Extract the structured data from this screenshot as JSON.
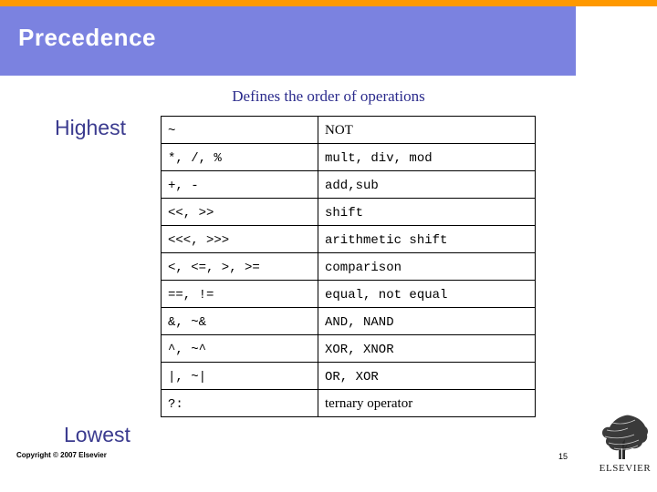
{
  "slide": {
    "title": "Precedence",
    "subtitle": "Defines the order of operations",
    "label_highest": "Highest",
    "label_lowest": "Lowest",
    "copyright": "Copyright © 2007 Elsevier",
    "page_number": "15",
    "logo_text": "ELSEVIER",
    "accent_bar_color": "#FF9900",
    "title_band_color": "#7B82E0",
    "title_text_color": "#FFFFFF",
    "subtitle_color": "#2B2B8C",
    "side_label_color": "#3B3B8F"
  },
  "table": {
    "rows": [
      {
        "operators": "~",
        "description": "NOT",
        "desc_font": "serif"
      },
      {
        "operators": "*, /, %",
        "description": "mult, div, mod",
        "desc_font": "mono"
      },
      {
        "operators": "+, -",
        "description": "add,sub",
        "desc_font": "mono"
      },
      {
        "operators": "<<, >>",
        "description": "shift",
        "desc_font": "mono"
      },
      {
        "operators": "<<<, >>>",
        "description": "arithmetic shift",
        "desc_font": "mono"
      },
      {
        "operators": "<, <=, >, >=",
        "description": "comparison",
        "desc_font": "mono"
      },
      {
        "operators": "==, !=",
        "description": "equal, not equal",
        "desc_font": "mono"
      },
      {
        "operators": "&, ~&",
        "description": "AND, NAND",
        "desc_font": "mono"
      },
      {
        "operators": "^, ~^",
        "description": "XOR, XNOR",
        "desc_font": "mono"
      },
      {
        "operators": "|, ~|",
        "description": "OR, XOR",
        "desc_font": "mono"
      },
      {
        "operators": "?:",
        "description": "ternary operator",
        "desc_font": "serif"
      }
    ]
  }
}
